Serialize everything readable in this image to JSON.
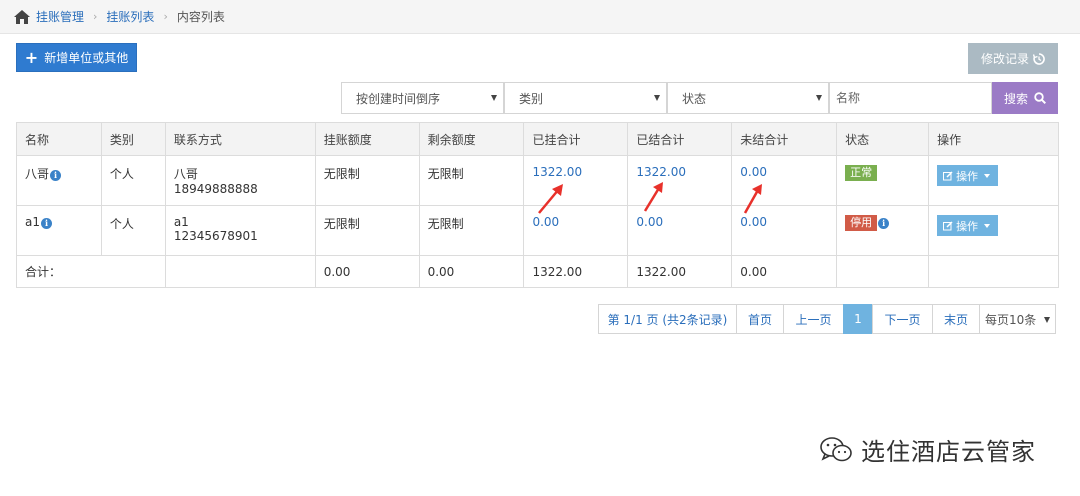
{
  "breadcrumb": {
    "level1": "挂账管理",
    "level2": "挂账列表",
    "current": "内容列表"
  },
  "toolbar": {
    "add_label": "新增单位或其他",
    "history_label": "修改记录"
  },
  "filters": {
    "sort_value": "按创建时间倒序",
    "category_value": "类别",
    "status_value": "状态",
    "name_placeholder": "名称",
    "search_label": "搜索"
  },
  "table": {
    "headers": [
      "名称",
      "类别",
      "联系方式",
      "挂账额度",
      "剩余额度",
      "已挂合计",
      "已结合计",
      "未结合计",
      "状态",
      "操作"
    ],
    "rows": [
      {
        "name": "八哥",
        "type": "个人",
        "contact_name": "八哥",
        "contact_phone": "18949888888",
        "credit_limit": "无限制",
        "remaining": "无限制",
        "charged_total": "1322.00",
        "settled_total": "1322.00",
        "unsettled_total": "0.00",
        "status": "正常",
        "action": "操作"
      },
      {
        "name": "a1",
        "type": "个人",
        "contact_name": "a1",
        "contact_phone": "12345678901",
        "credit_limit": "无限制",
        "remaining": "无限制",
        "charged_total": "0.00",
        "settled_total": "0.00",
        "unsettled_total": "0.00",
        "status": "停用",
        "action": "操作"
      }
    ],
    "summary": {
      "label": "合计：",
      "credit_limit": "0.00",
      "remaining": "0.00",
      "charged_total": "1322.00",
      "settled_total": "1322.00",
      "unsettled_total": "0.00"
    }
  },
  "pagination": {
    "info": "第 1/1 页 (共2条记录)",
    "first": "首页",
    "prev": "上一页",
    "current": "1",
    "next": "下一页",
    "last": "末页",
    "page_size": "每页10条"
  },
  "watermark": "选住酒店云管家",
  "colors": {
    "primary": "#2f7bd0",
    "search": "#9b7bc6",
    "ok": "#7aaf4f",
    "off": "#d15b47",
    "annotation": "#e8312b"
  }
}
